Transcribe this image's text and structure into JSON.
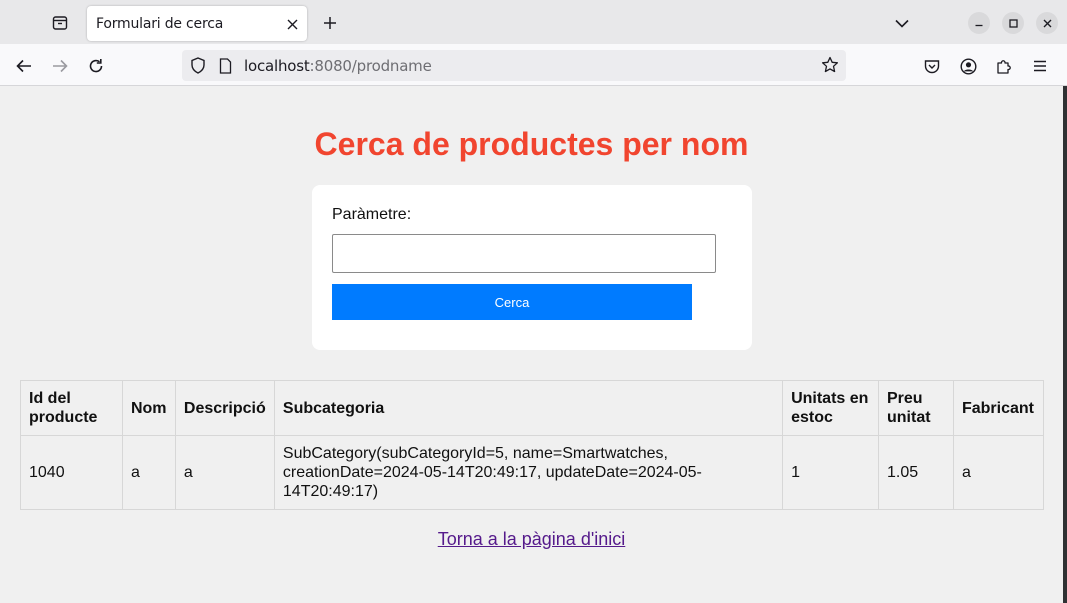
{
  "browser": {
    "tab_title": "Formulari de cerca",
    "url_host": "localhost",
    "url_rest": ":8080/prodname"
  },
  "page": {
    "heading": "Cerca de productes per nom",
    "form": {
      "label": "Paràmetre:",
      "input_value": "",
      "button_label": "Cerca"
    },
    "table": {
      "headers": [
        "Id del producte",
        "Nom",
        "Descripció",
        "Subcategoria",
        "Unitats en estoc",
        "Preu unitat",
        "Fabricant"
      ],
      "rows": [
        [
          "1040",
          "a",
          "a",
          "SubCategory(subCategoryId=5, name=Smartwatches, creationDate=2024-05-14T20:49:17, updateDate=2024-05-14T20:49:17)",
          "1",
          "1.05",
          "a"
        ]
      ]
    },
    "back_link": "Torna a la pàgina d'inici"
  },
  "colors": {
    "heading": "#f1452f",
    "button": "#007bff",
    "link": "#551a8b"
  }
}
